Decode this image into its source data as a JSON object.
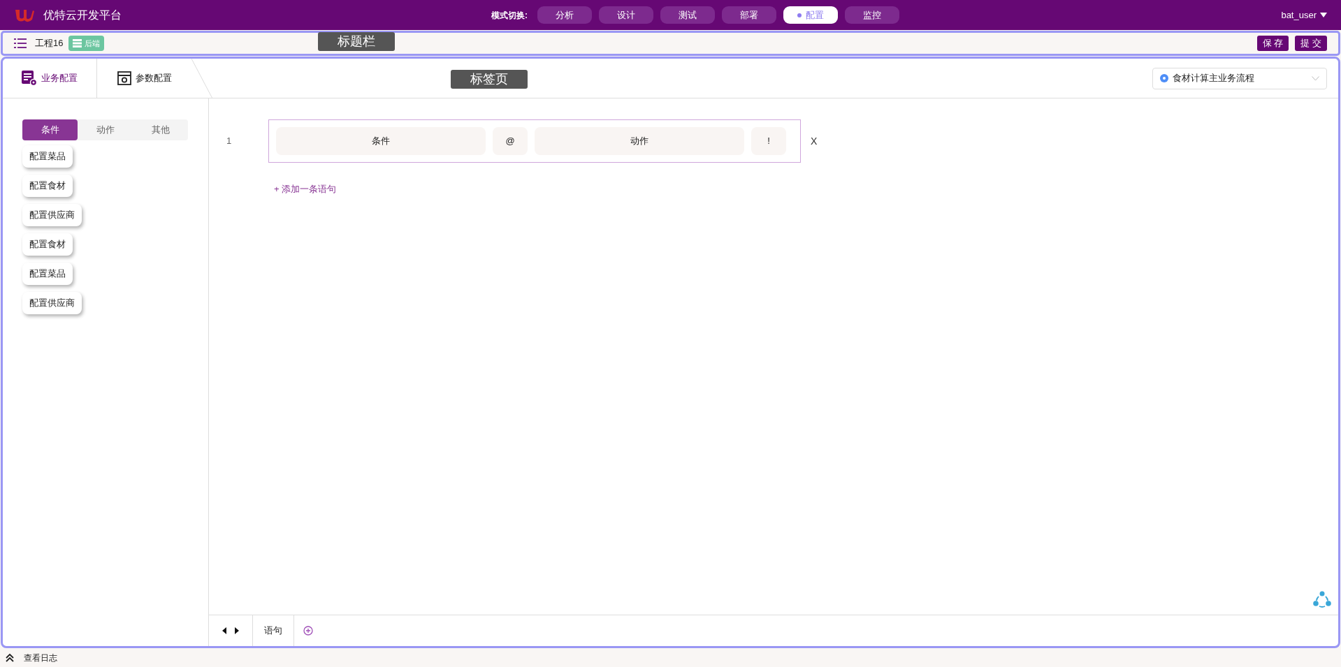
{
  "app": {
    "title": "优特云开发平台",
    "mode_label": "模式切换:",
    "modes": [
      {
        "label": "分析",
        "selected": false
      },
      {
        "label": "设计",
        "selected": false
      },
      {
        "label": "测试",
        "selected": false
      },
      {
        "label": "部署",
        "selected": false
      },
      {
        "label": "配置",
        "selected": true
      },
      {
        "label": "监控",
        "selected": false
      }
    ],
    "user": "bat_user"
  },
  "title_bar": {
    "project": "工程16",
    "tag": "后端",
    "buttons": [
      "保 存",
      "提 交"
    ]
  },
  "annotations": [
    "标题栏",
    "标签页"
  ],
  "tabs": [
    {
      "label": "业务配置",
      "selected": true
    },
    {
      "label": "参数配置",
      "selected": false
    }
  ],
  "flow_select": {
    "value": "食材计算主业务流程"
  },
  "palette": {
    "segments": [
      {
        "label": "条件",
        "selected": true
      },
      {
        "label": "动作",
        "selected": false
      },
      {
        "label": "其他",
        "selected": false
      }
    ],
    "items": [
      "配置菜品",
      "配置食材",
      "配置供应商",
      "配置食材",
      "配置菜品",
      "配置供应商"
    ]
  },
  "statements": [
    {
      "number": "1",
      "slots": [
        {
          "text": "条件",
          "kind": "field"
        },
        {
          "text": "@",
          "kind": "symbol"
        },
        {
          "text": "动作",
          "kind": "field"
        },
        {
          "text": "!",
          "kind": "symbol"
        }
      ],
      "remove": "X"
    }
  ],
  "add_statement": "+ 添加一条语句",
  "bottom_tab": "语句",
  "status_bar": {
    "log": "查看日志"
  }
}
